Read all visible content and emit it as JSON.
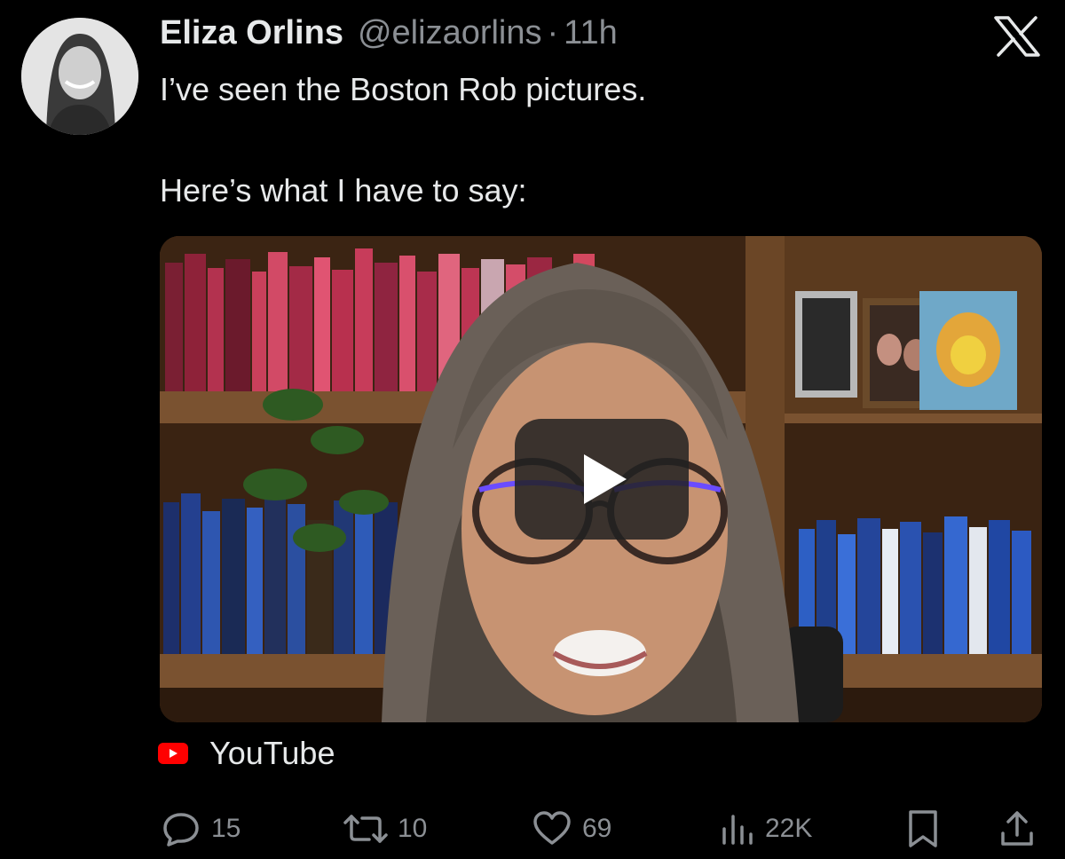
{
  "tweet": {
    "author_name": "Eliza Orlins",
    "handle": "@elizaorlins",
    "separator": "·",
    "time": "11h",
    "line1": "I’ve seen the Boston Rob pictures.",
    "line2": "Here’s what I have to say:"
  },
  "media": {
    "source_label": "YouTube"
  },
  "actions": {
    "replies": "15",
    "retweets": "10",
    "likes": "69",
    "views": "22K"
  },
  "icons": {
    "platform": "x-logo-icon",
    "reply": "speech-bubble-icon",
    "retweet": "retweet-arrows-icon",
    "like": "heart-icon",
    "views": "bar-chart-icon",
    "bookmark": "bookmark-icon",
    "share": "share-upload-icon",
    "play": "play-button-icon",
    "source": "youtube-logo-icon"
  },
  "colors": {
    "background": "#000000",
    "text": "#e7e9ea",
    "secondary": "#8b8f94",
    "youtube_red": "#ff0000"
  }
}
